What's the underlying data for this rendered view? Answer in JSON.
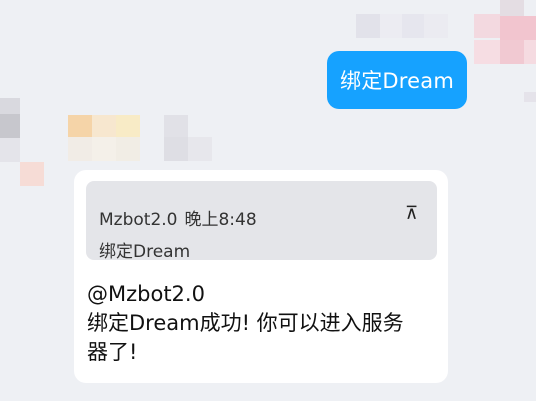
{
  "chat": {
    "outgoing": {
      "text": "绑定Dream",
      "color": "#16a2ff"
    },
    "incoming": {
      "quote": {
        "sender": "Mzbot2.0",
        "time": "晚上8:48",
        "icon": "quote-collapse-icon",
        "icon_glyph": "⊼",
        "text": "绑定Dream"
      },
      "reply_lines": [
        "@Mzbot2.0",
        "绑定Dream成功! 你可以进入服务",
        "器了!"
      ]
    }
  }
}
